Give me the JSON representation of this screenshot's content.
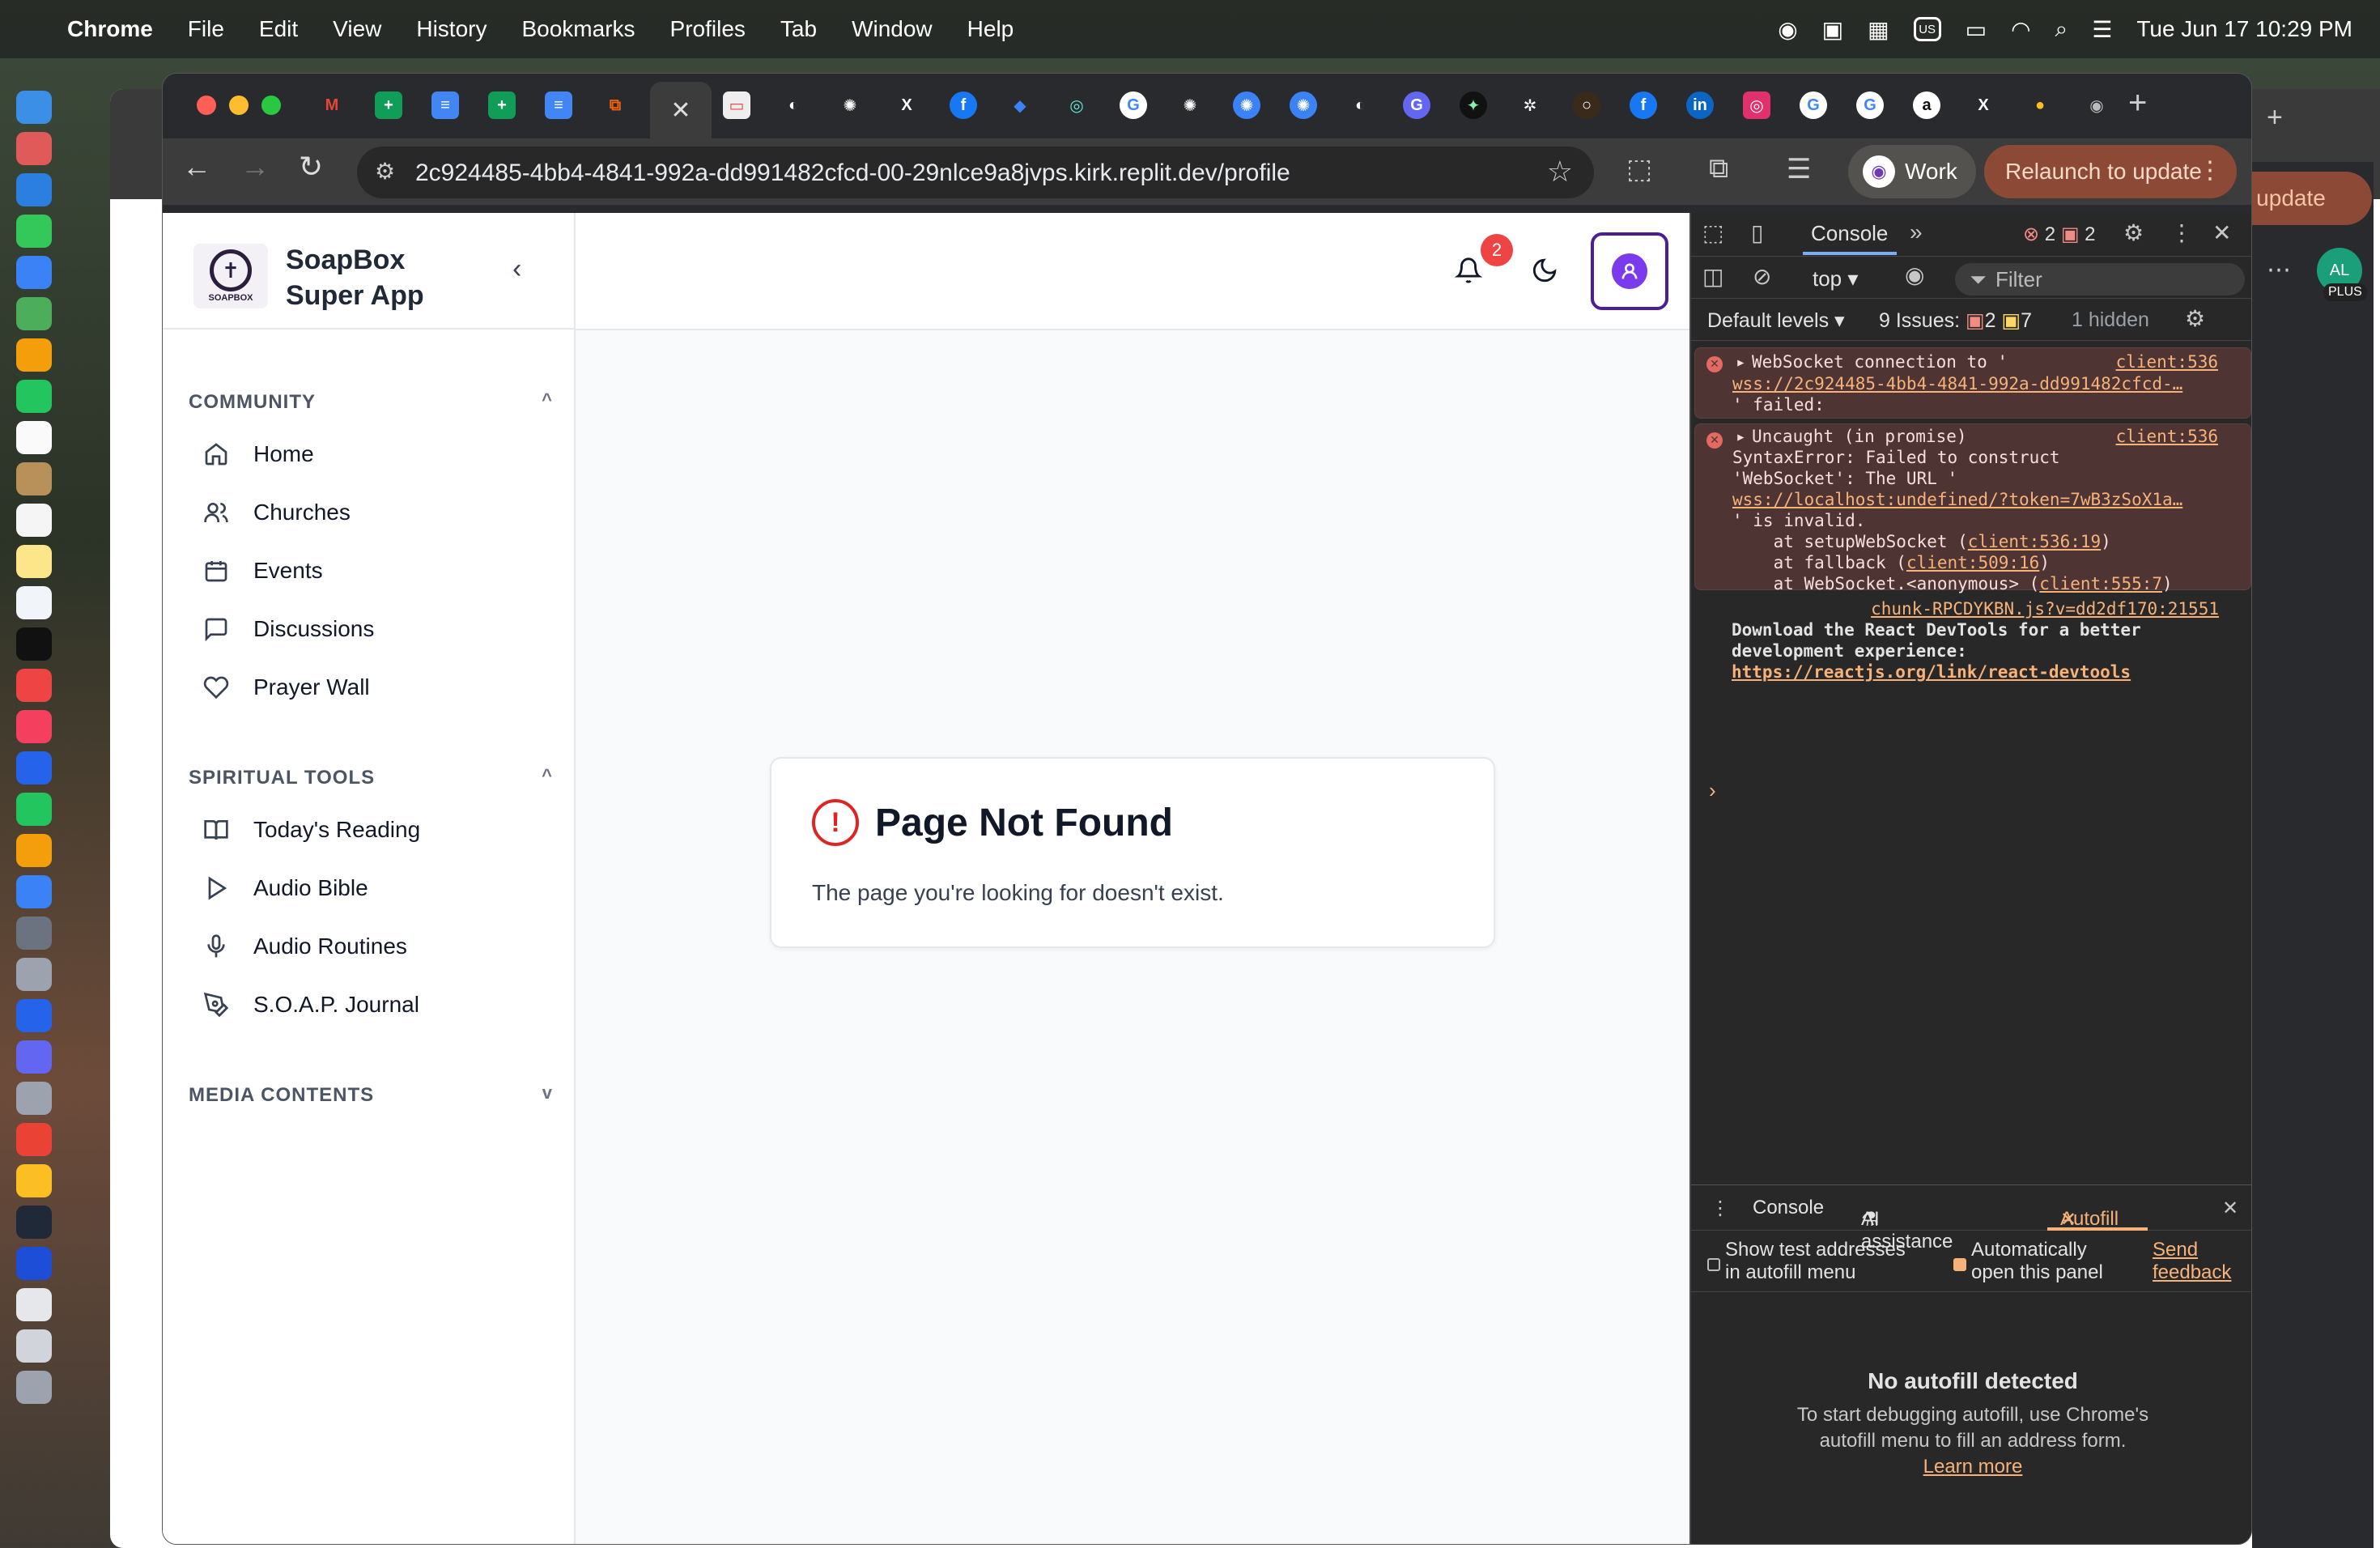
{
  "menubar": {
    "app_name": "Chrome",
    "menus": [
      "File",
      "Edit",
      "View",
      "History",
      "Bookmarks",
      "Profiles",
      "Tab",
      "Window",
      "Help"
    ],
    "input_source": "US",
    "datetime": "Tue Jun 17  10:29 PM"
  },
  "browser": {
    "url": "2c924485-4bb4-4841-992a-dd991482cfcd-00-29nlce9a8jvps.kirk.replit.dev/profile",
    "profile_label": "Work",
    "relaunch_label": "Relaunch to update",
    "background_window_update": "update",
    "background_avatar": "AL",
    "background_avatar_badge": "PLUS"
  },
  "sidebar": {
    "brand_line1": "SoapBox",
    "brand_line2": "Super App",
    "logo_text": "SOAPBOX",
    "community_title": "COMMUNITY",
    "community_items": [
      {
        "label": "Home",
        "icon": "home-icon"
      },
      {
        "label": "Churches",
        "icon": "users-icon"
      },
      {
        "label": "Events",
        "icon": "calendar-icon"
      },
      {
        "label": "Discussions",
        "icon": "message-square-icon"
      },
      {
        "label": "Prayer Wall",
        "icon": "heart-icon"
      }
    ],
    "spiritual_title": "SPIRITUAL TOOLS",
    "spiritual_items": [
      {
        "label": "Today's Reading",
        "icon": "book-open-icon"
      },
      {
        "label": "Audio Bible",
        "icon": "play-icon"
      },
      {
        "label": "Audio Routines",
        "icon": "mic-icon"
      },
      {
        "label": "S.O.A.P. Journal",
        "icon": "pen-tool-icon"
      }
    ],
    "media_title": "MEDIA CONTENTS"
  },
  "header": {
    "notification_count": "2"
  },
  "not_found": {
    "title": "Page Not Found",
    "message": "The page you're looking for doesn't exist."
  },
  "devtools": {
    "tab_console": "Console",
    "error_count": "2",
    "issue_count_badge": "2",
    "context": "top",
    "filter_placeholder": "Filter",
    "levels": "Default levels",
    "issues_label": "9 Issues:",
    "issues_errors": "2",
    "issues_warnings": "7",
    "hidden": "1 hidden",
    "msg1": {
      "line1": "WebSocket connection to '",
      "line2": "wss://2c924485-4bb4-4841-992a-dd991482cfcd-…",
      "line3": "' failed:",
      "source": "client:536"
    },
    "msg2": {
      "line1": "Uncaught (in promise)",
      "line2": "SyntaxError: Failed to construct",
      "line3": "'WebSocket': The URL '",
      "line4": "wss://localhost:undefined/?token=7wB3zSoX1a…",
      "line5": "' is invalid.",
      "trace1_pre": "    at setupWebSocket (",
      "trace1_link": "client:536:19",
      "trace2_pre": "    at fallback (",
      "trace2_link": "client:509:16",
      "trace3_pre": "    at WebSocket.<anonymous> (",
      "trace3_link": "client:555:7",
      "source": "client:536"
    },
    "msg3": {
      "source": "chunk-RPCDYKBN.js?v=dd2df170:21551",
      "line1": "Download the React DevTools for a better",
      "line2": "development experience:",
      "link": "https://reactjs.org/link/react-devtools"
    },
    "drawer": {
      "tab_console": "Console",
      "tab_ai": "AI assistance",
      "tab_autofill": "Autofill",
      "opt1_line1": "Show test addresses",
      "opt1_line2": "in autofill menu",
      "opt2_line1": "Automatically",
      "opt2_line2": "open this panel",
      "feedback_line1": "Send",
      "feedback_line2": "feedback",
      "empty_title": "No autofill detected",
      "empty_text": "To start debugging autofill, use Chrome's autofill menu to fill an address form.",
      "learn_more": "Learn more"
    }
  }
}
